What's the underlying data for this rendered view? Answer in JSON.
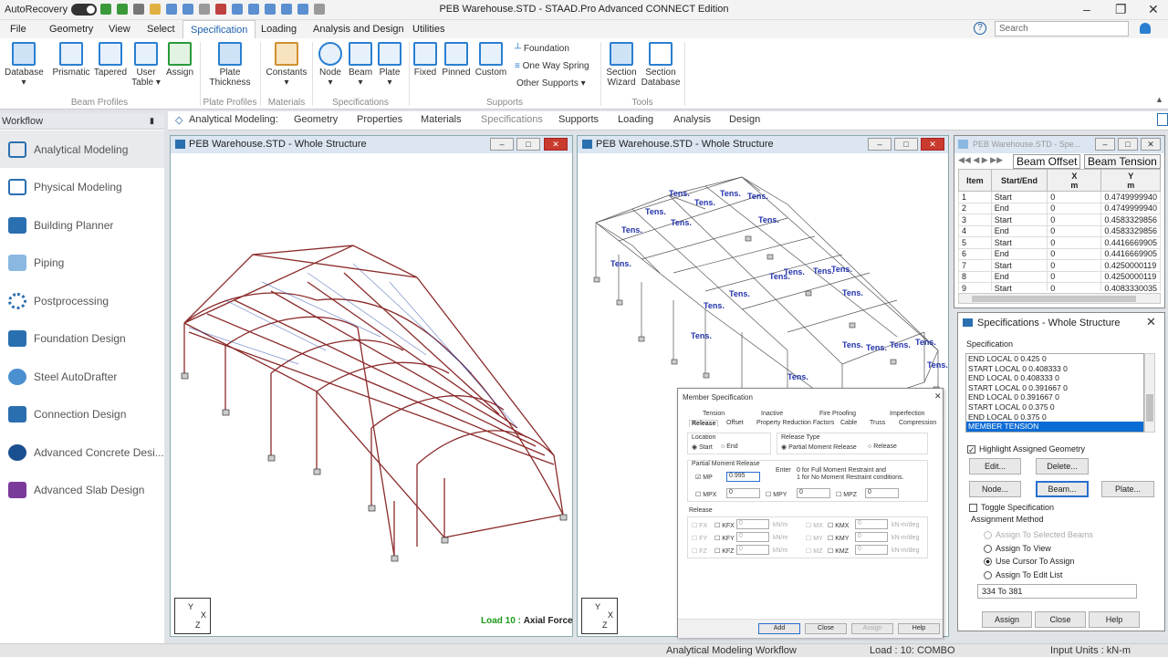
{
  "app": {
    "title": "PEB Warehouse.STD - STAAD.Pro Advanced CONNECT Edition",
    "autorecovery": "AutoRecovery"
  },
  "menu": [
    "File",
    "Geometry",
    "View",
    "Select",
    "Specification",
    "Loading",
    "Analysis and Design",
    "Utilities"
  ],
  "menu_active": "Specification",
  "search": {
    "placeholder": "Search"
  },
  "ribbon": {
    "beam_profiles": {
      "label": "Beam Profiles",
      "database": "Database",
      "prismatic": "Prismatic",
      "tapered": "Tapered",
      "user_table": "User Table",
      "assign": "Assign"
    },
    "plate_profiles": {
      "label": "Plate Profiles",
      "plate_thickness": "Plate Thickness"
    },
    "materials": {
      "label": "Materials",
      "constants": "Constants"
    },
    "specifications": {
      "label": "Specifications",
      "node": "Node",
      "beam": "Beam",
      "plate": "Plate"
    },
    "supports": {
      "label": "Supports",
      "fixed": "Fixed",
      "pinned": "Pinned",
      "custom": "Custom",
      "foundation": "Foundation",
      "one_way_spring": "One Way Spring",
      "other_supports": "Other Supports"
    },
    "tools": {
      "label": "Tools",
      "section_wizard": "Section Wizard",
      "section_database": "Section Database"
    }
  },
  "workflow": {
    "header": "Workflow",
    "items": [
      "Analytical Modeling",
      "Physical Modeling",
      "Building Planner",
      "Piping",
      "Postprocessing",
      "Foundation Design",
      "Steel AutoDrafter",
      "Connection Design",
      "Advanced Concrete Desi...",
      "Advanced Slab Design"
    ]
  },
  "subtabs": {
    "label": "Analytical Modeling:",
    "items": [
      "Geometry",
      "Properties",
      "Materials",
      "Specifications",
      "Supports",
      "Loading",
      "Analysis",
      "Design"
    ],
    "active": "Specifications"
  },
  "view1": {
    "title": "PEB Warehouse.STD - Whole Structure",
    "load_prefix": "Load 10 :",
    "load_name": "Axial Force"
  },
  "view2": {
    "title": "PEB Warehouse.STD - Whole Structure",
    "tens_label": "Tens."
  },
  "axis": {
    "y": "Y",
    "x": "X",
    "z": "Z"
  },
  "table_window": {
    "title": "PEB Warehouse.STD - Spe...",
    "tabs": [
      "Beam Offset",
      "Beam Tension"
    ],
    "columns": [
      "Item",
      "Start/End",
      "X",
      "Y"
    ],
    "units": [
      "",
      "",
      "m",
      "m"
    ],
    "rows": [
      [
        "1",
        "Start",
        "0",
        "0.4749999940"
      ],
      [
        "2",
        "End",
        "0",
        "0.4749999940"
      ],
      [
        "3",
        "Start",
        "0",
        "0.4583329856"
      ],
      [
        "4",
        "End",
        "0",
        "0.4583329856"
      ],
      [
        "5",
        "Start",
        "0",
        "0.4416669905"
      ],
      [
        "6",
        "End",
        "0",
        "0.4416669905"
      ],
      [
        "7",
        "Start",
        "0",
        "0.4250000119"
      ],
      [
        "8",
        "End",
        "0",
        "0.4250000119"
      ],
      [
        "9",
        "Start",
        "0",
        "0.4083330035"
      ]
    ]
  },
  "spec_panel": {
    "title": "Specifications - Whole Structure",
    "section": "Specification",
    "list": [
      "END LOCAL 0 0.425 0",
      "START LOCAL 0 0.408333 0",
      "END LOCAL 0 0.408333 0",
      "START LOCAL 0 0.391667 0",
      "END LOCAL 0 0.391667 0",
      "START LOCAL 0 0.375 0",
      "END LOCAL 0 0.375 0",
      "MEMBER TENSION"
    ],
    "highlight": "Highlight Assigned Geometry",
    "edit": "Edit...",
    "delete": "Delete...",
    "node": "Node...",
    "beam": "Beam...",
    "plate": "Plate...",
    "toggle": "Toggle Specification",
    "assignment_method": "Assignment Method",
    "methods": [
      "Assign To Selected Beams",
      "Assign To View",
      "Use Cursor To Assign",
      "Assign To Edit List"
    ],
    "edit_list": "334 To 381",
    "assign": "Assign",
    "close": "Close",
    "help": "Help"
  },
  "member_spec": {
    "title": "Member Specification",
    "tabs_top": [
      "Tension",
      "Inactive",
      "Fire Proofing",
      "Imperfection"
    ],
    "tabs_bottom": [
      "Release",
      "Offset",
      "Property Reduction Factors",
      "Cable",
      "Truss",
      "Compression"
    ],
    "location": "Location",
    "start": "Start",
    "end": "End",
    "release_type": "Release Type",
    "partial": "Partial Moment Release",
    "release": "Release",
    "pmr": "Partial Moment Release",
    "enter": "Enter",
    "note1": "0 for Full Moment Restraint and",
    "note2": "1 for No Moment Restraint conditions.",
    "mp": "MP",
    "mp_val": "0.995",
    "mpx": "MPX",
    "mpy": "MPY",
    "mpz": "MPZ",
    "zero": "0",
    "rel_title": "Release",
    "fx": "FX",
    "fy": "FY",
    "fz": "FZ",
    "kfx": "KFX",
    "kfy": "KFY",
    "kfz": "KFZ",
    "mx": "MX",
    "my": "MY",
    "mz": "MZ",
    "kmx": "KMX",
    "kmy": "KMY",
    "kmz": "KMZ",
    "unit_f": "kN/m",
    "unit_m": "kN-m/deg",
    "add": "Add",
    "close": "Close",
    "assign": "Assign",
    "help": "Help"
  },
  "status": {
    "workflow": "Analytical Modeling Workflow",
    "load": "Load : 10: COMBO",
    "units": "Input Units : kN-m"
  },
  "colors": {
    "accent": "#1a5fa8",
    "frame": "#8b2a2a",
    "tens": "#2233aa",
    "load_green": "#1a9a1a"
  }
}
